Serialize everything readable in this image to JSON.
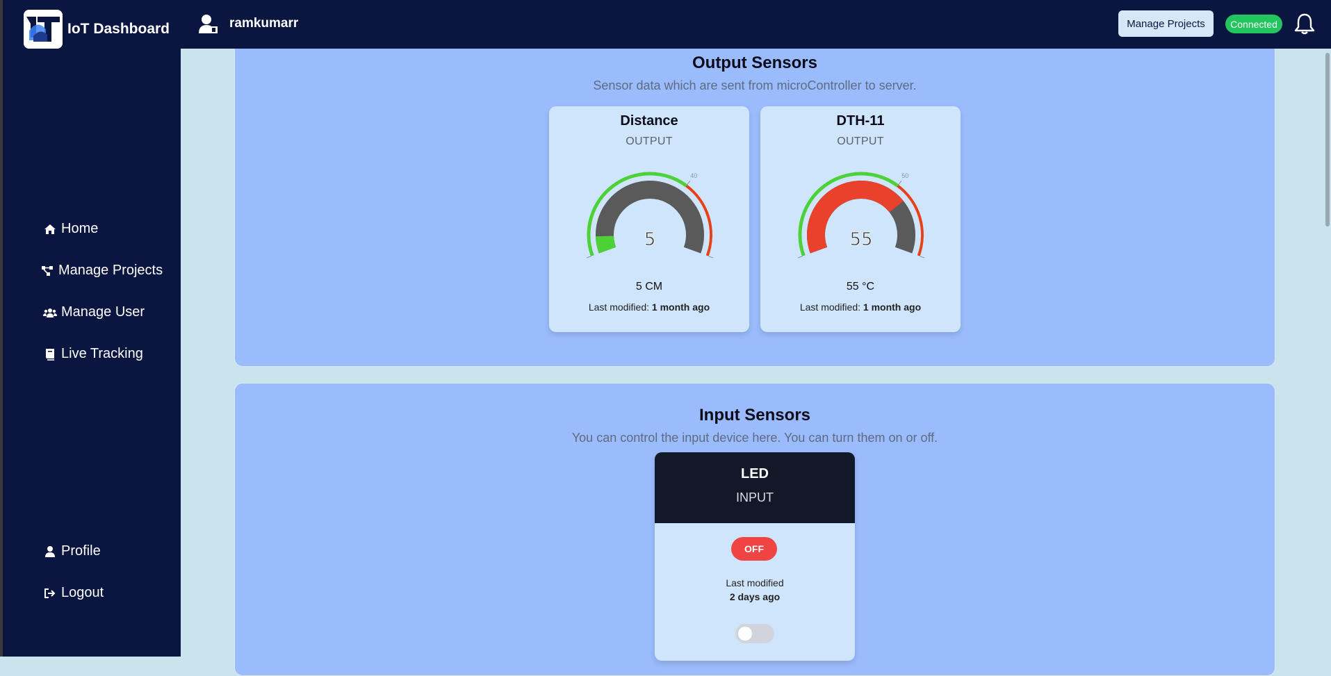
{
  "app": {
    "title": "IoT Dashboard",
    "username": "ramkumarr"
  },
  "header": {
    "manage_button": "Manage Projects",
    "status": "Connected",
    "status_color": "#22c55e"
  },
  "sidebar": {
    "items": [
      {
        "label": "Home",
        "icon": "home-icon"
      },
      {
        "label": "Manage Projects",
        "icon": "project-tree-icon"
      },
      {
        "label": "Manage User",
        "icon": "users-icon"
      },
      {
        "label": "Live Tracking",
        "icon": "book-icon"
      }
    ],
    "bottom": [
      {
        "label": "Profile",
        "icon": "user-icon"
      },
      {
        "label": "Logout",
        "icon": "logout-icon"
      }
    ]
  },
  "output_section": {
    "title": "Output Sensors",
    "subtitle": "Sensor data which are sent from microController to server.",
    "sensors": [
      {
        "name": "Distance",
        "type": "OUTPUT",
        "value": "5",
        "reading": "5 CM",
        "gauge": {
          "min": 0,
          "max": 60,
          "threshold": 40,
          "value": 5,
          "min_label": "0",
          "max_label": "60",
          "threshold_label": "40"
        },
        "modified_label": "Last modified:",
        "modified": "1 month ago"
      },
      {
        "name": "DTH-11",
        "type": "OUTPUT",
        "value": "55",
        "reading": "55 °C",
        "gauge": {
          "min": 0,
          "max": 75,
          "threshold": 50,
          "value": 55,
          "min_label": "0",
          "max_label": "75",
          "threshold_label": "50"
        },
        "modified_label": "Last modified:",
        "modified": "1 month ago"
      }
    ]
  },
  "input_section": {
    "title": "Input Sensors",
    "subtitle": "You can control the input device here. You can turn them on or off.",
    "device": {
      "name": "LED",
      "type": "INPUT",
      "state": "OFF",
      "modified_label": "Last modified",
      "modified": "2 days ago",
      "toggle_on": false
    }
  }
}
